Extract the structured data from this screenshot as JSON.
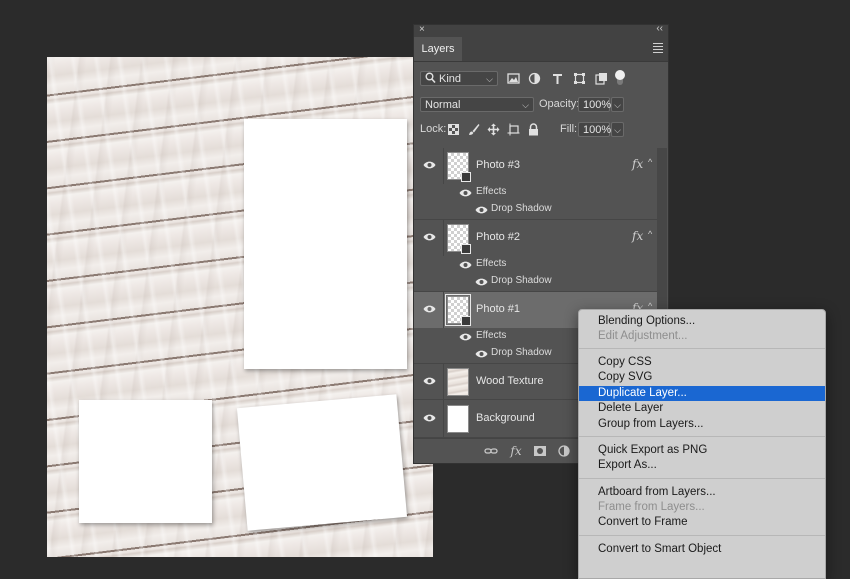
{
  "panel": {
    "tab_label": "Layers",
    "close_glyph": "×",
    "collapse_glyph": "‹‹",
    "filter_kind": "Kind",
    "blend_mode": "Normal",
    "opacity_label": "Opacity:",
    "opacity_value": "100%",
    "lock_label": "Lock:",
    "fill_label": "Fill:",
    "fill_value": "100%",
    "fx_glyph": "fx",
    "layers": [
      {
        "name": "Photo #3",
        "effects_label": "Effects",
        "effect": "Drop Shadow"
      },
      {
        "name": "Photo #2",
        "effects_label": "Effects",
        "effect": "Drop Shadow"
      },
      {
        "name": "Photo #1",
        "effects_label": "Effects",
        "effect": "Drop Shadow",
        "selected": true
      },
      {
        "name": "Wood Texture"
      },
      {
        "name": "Background"
      }
    ]
  },
  "context_menu": {
    "items": [
      {
        "label": "Blending Options...",
        "enabled": true
      },
      {
        "label": "Edit Adjustment...",
        "enabled": false
      },
      {
        "label": "Copy CSS",
        "enabled": true
      },
      {
        "label": "Copy SVG",
        "enabled": true
      },
      {
        "label": "Duplicate Layer...",
        "enabled": true,
        "highlighted": true
      },
      {
        "label": "Delete Layer",
        "enabled": true
      },
      {
        "label": "Group from Layers...",
        "enabled": true
      },
      {
        "label": "Quick Export as PNG",
        "enabled": true
      },
      {
        "label": "Export As...",
        "enabled": true
      },
      {
        "label": "Artboard from Layers...",
        "enabled": true
      },
      {
        "label": "Frame from Layers...",
        "enabled": false
      },
      {
        "label": "Convert to Frame",
        "enabled": true
      },
      {
        "label": "Convert to Smart Object",
        "enabled": true
      }
    ]
  },
  "colors": {
    "app_background": "#2b2b2b",
    "panel_background": "#535353",
    "menu_background": "#cfcfcf",
    "menu_highlight": "#1a67d2"
  }
}
